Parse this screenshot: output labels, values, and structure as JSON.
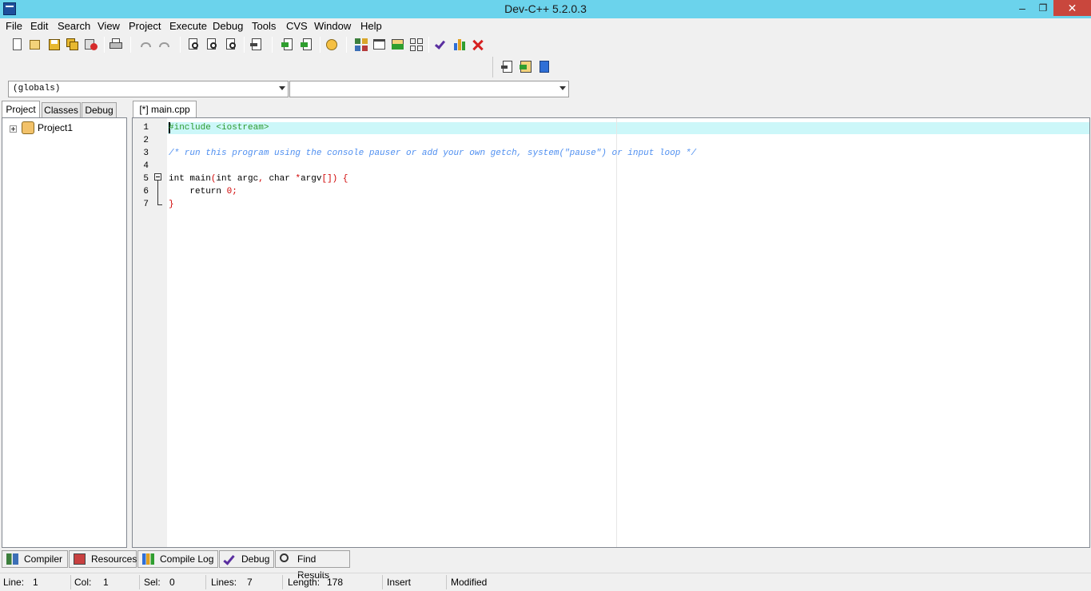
{
  "window": {
    "title": "Dev-C++ 5.2.0.3",
    "minimize": "–",
    "maximize": "❐",
    "close": "✕"
  },
  "menu": [
    "File",
    "Edit",
    "Search",
    "View",
    "Project",
    "Execute",
    "Debug",
    "Tools",
    "CVS",
    "Window",
    "Help"
  ],
  "combos": {
    "scope": "(globals)",
    "member": ""
  },
  "left_tabs": [
    "Project",
    "Classes",
    "Debug"
  ],
  "tree": {
    "project": "Project1"
  },
  "editor": {
    "tab": "[*] main.cpp",
    "line_numbers": [
      "1",
      "2",
      "3",
      "4",
      "5",
      "6",
      "7"
    ],
    "lines": {
      "l1": "#include <iostream>",
      "l3": "/* run this program using the console pauser or add your own getch, system(\"pause\") or input loop */",
      "l5_kw": "int main",
      "l5_p1": "(",
      "l5_mid": "int argc",
      "l5_comma": ",",
      "l5_char": " char ",
      "l5_star": "*",
      "l5_argv": "argv",
      "l5_end": "[]) {",
      "l6_kw": "    return ",
      "l6_num": "0",
      "l6_semi": ";",
      "l7": "}"
    }
  },
  "bottom_tabs": [
    "Compiler",
    "Resources",
    "Compile Log",
    "Debug",
    "Find Results"
  ],
  "status": {
    "line_label": "Line:",
    "line": "1",
    "col_label": "Col:",
    "col": "1",
    "sel_label": "Sel:",
    "sel": "0",
    "lines_label": "Lines:",
    "lines": "7",
    "length_label": "Length:",
    "length": "178",
    "mode": "Insert",
    "modified": "Modified"
  },
  "colors": {
    "titlebar": "#6bd3ec",
    "close": "#c9473d",
    "current_line": "#ccf7f9",
    "comment": "#4f8ff0",
    "preprocessor": "#2e9a2e",
    "symbol": "#d00000"
  }
}
